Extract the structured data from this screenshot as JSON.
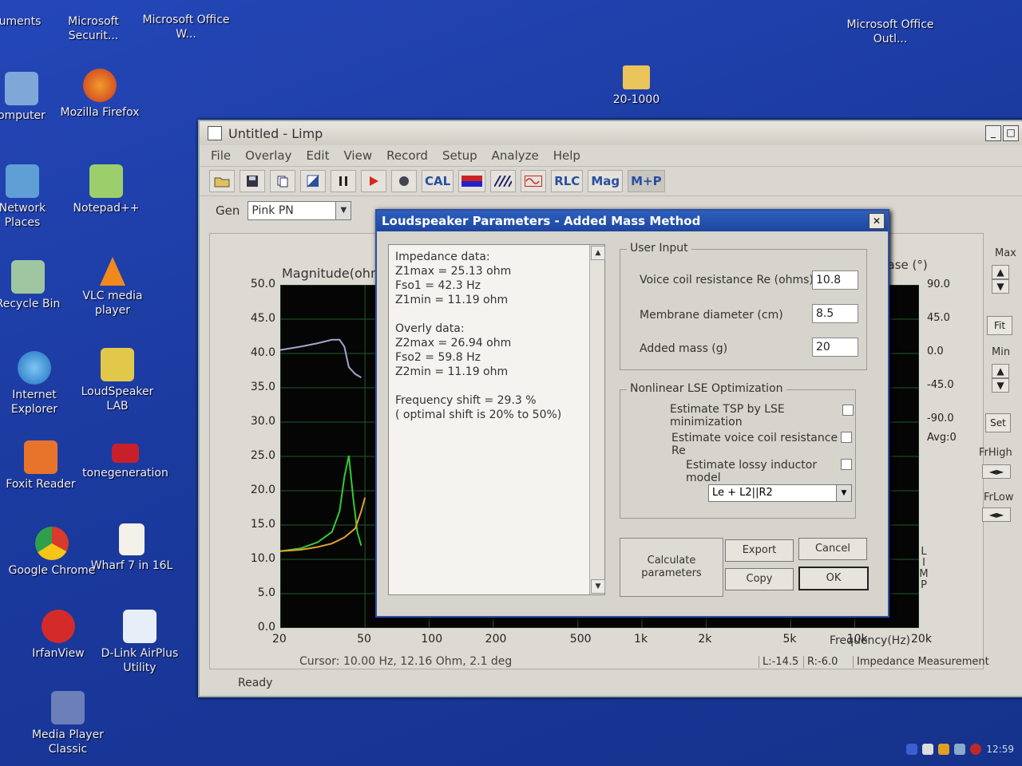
{
  "desktop": {
    "icons": [
      {
        "label": "uments"
      },
      {
        "label": "Microsoft Securit..."
      },
      {
        "label": "Microsoft Office W..."
      },
      {
        "label": "Microsoft Office Outl..."
      },
      {
        "label": "omputer"
      },
      {
        "label": "Mozilla Firefox"
      },
      {
        "label": "20-1000"
      },
      {
        "label": "Network Places"
      },
      {
        "label": "Notepad++"
      },
      {
        "label": "Recycle Bin"
      },
      {
        "label": "VLC media player"
      },
      {
        "label": "Internet Explorer"
      },
      {
        "label": "LoudSpeaker LAB"
      },
      {
        "label": "Foxit Reader"
      },
      {
        "label": "tonegeneration"
      },
      {
        "label": "Google Chrome"
      },
      {
        "label": "Wharf 7 in 16L"
      },
      {
        "label": "IrfanView"
      },
      {
        "label": "D-Link AirPlus Utility"
      },
      {
        "label": "Media Player Classic"
      }
    ],
    "tray_time": "12:59"
  },
  "window": {
    "title": "Untitled - Limp",
    "menu": [
      "File",
      "Overlay",
      "Edit",
      "View",
      "Record",
      "Setup",
      "Analyze",
      "Help"
    ],
    "toolbar_text": {
      "cal": "CAL",
      "rlc": "RLC",
      "mag": "Mag",
      "mp": "M+P"
    },
    "gen_label": "Gen",
    "gen_value": "Pink PN",
    "status": "Ready"
  },
  "chart_data": {
    "type": "line",
    "ylabel": "Magnitude(ohm)",
    "y2label": "Phase (°)",
    "xlabel": "Frequency(Hz)",
    "ylim": [
      0,
      50
    ],
    "y2lim": [
      -90,
      90
    ],
    "xscale": "log",
    "xlim": [
      20,
      20000
    ],
    "yticks": [
      "50.0",
      "45.0",
      "40.0",
      "35.0",
      "30.0",
      "25.0",
      "20.0",
      "15.0",
      "10.0",
      "5.0",
      "0.0"
    ],
    "y2ticks": [
      "90.0",
      "45.0",
      "0.0",
      "-45.0",
      "-90.0"
    ],
    "xticks": [
      "20",
      "50",
      "100",
      "200",
      "500",
      "1k",
      "2k",
      "5k",
      "10k",
      "20k"
    ],
    "avg_label": "Avg:0",
    "series": [
      {
        "color": "#a0a6c8",
        "x": [
          20,
          25,
          30,
          35,
          38,
          40,
          42,
          45,
          48
        ],
        "y": [
          40.5,
          41,
          41.5,
          42,
          42,
          41,
          38,
          37,
          36.5
        ]
      },
      {
        "color": "#33cc33",
        "x": [
          20,
          25,
          30,
          35,
          38,
          40,
          42,
          44,
          46,
          48
        ],
        "y": [
          11.2,
          11.6,
          12.5,
          14,
          17,
          22,
          25.1,
          19,
          14,
          12
        ]
      },
      {
        "color": "#e0a030",
        "x": [
          20,
          25,
          30,
          35,
          40,
          45,
          48,
          50
        ],
        "y": [
          11.2,
          11.4,
          11.8,
          12.3,
          13.2,
          14.5,
          17,
          19
        ]
      }
    ],
    "cursor": "Cursor: 10.00 Hz, 12.16 Ohm, 2.1 deg",
    "status_l": "L:-14.5",
    "status_r": "R:-6.0",
    "status_mode": "Impedance Measurement",
    "side_letters": [
      "L",
      "I",
      "M",
      "P"
    ]
  },
  "right_panel": {
    "max": "Max",
    "fit": "Fit",
    "min": "Min",
    "set": "Set",
    "frhigh": "FrHigh",
    "frlow": "FrLow"
  },
  "dialog": {
    "title": "Loudspeaker Parameters - Added Mass Method",
    "report": [
      "Impedance data:",
      "Z1max =  25.13 ohm",
      "Fso1 = 42.3 Hz",
      "Z1min = 11.19 ohm",
      "",
      "Overly data:",
      "Z2max =  26.94 ohm",
      "Fso2 = 59.8 Hz",
      "Z2min = 11.19 ohm",
      "",
      "Frequency shift = 29.3 %",
      "( optimal shift is 20% to 50%)"
    ],
    "user_input_title": "User Input",
    "re_label": "Voice coil resistance Re (ohms)",
    "re_value": "10.8",
    "diam_label": "Membrane diameter (cm)",
    "diam_value": "8.5",
    "mass_label": "Added mass (g)",
    "mass_value": "20",
    "lse_title": "Nonlinear LSE Optimization",
    "lse_opt1": "Estimate TSP by LSE minimization",
    "lse_opt2": "Estimate voice coil resistance Re",
    "lse_opt3": "Estimate lossy inductor model",
    "model_value": "Le + L2||R2",
    "calc_label": "Calculate parameters",
    "export_label": "Export",
    "cancel_label": "Cancel",
    "copy_label": "Copy",
    "ok_label": "OK"
  }
}
